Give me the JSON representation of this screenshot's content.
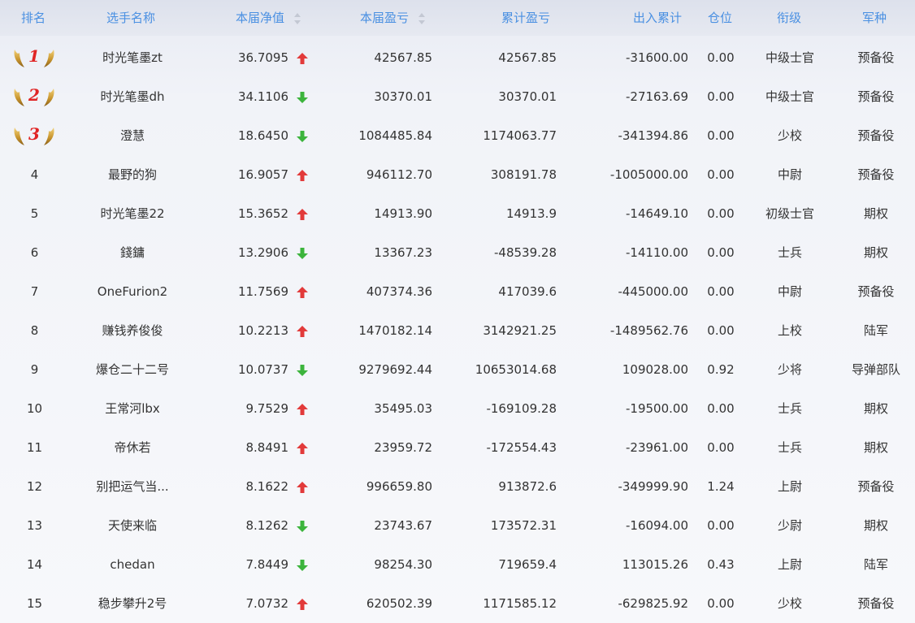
{
  "headers": {
    "rank": "排名",
    "name": "选手名称",
    "nav": "本届净值",
    "current_pnl": "本届盈亏",
    "cumulative_pnl": "累计盈亏",
    "inout": "出入累计",
    "position": "仓位",
    "grade": "衔级",
    "arm": "军种"
  },
  "colors": {
    "accent": "#4a90e2",
    "up": "#e23a3a",
    "down": "#3cb43c",
    "medal_number": "#e02525"
  },
  "rows": [
    {
      "rank": "1",
      "medal": true,
      "name": "时光笔墨zt",
      "nav": "36.7095",
      "trend": "up",
      "current_pnl": "42567.85",
      "cumulative_pnl": "42567.85",
      "inout": "-31600.00",
      "position": "0.00",
      "grade": "中级士官",
      "arm": "预备役"
    },
    {
      "rank": "2",
      "medal": true,
      "name": "时光笔墨dh",
      "nav": "34.1106",
      "trend": "down",
      "current_pnl": "30370.01",
      "cumulative_pnl": "30370.01",
      "inout": "-27163.69",
      "position": "0.00",
      "grade": "中级士官",
      "arm": "预备役"
    },
    {
      "rank": "3",
      "medal": true,
      "name": "澄慧",
      "nav": "18.6450",
      "trend": "down",
      "current_pnl": "1084485.84",
      "cumulative_pnl": "1174063.77",
      "inout": "-341394.86",
      "position": "0.00",
      "grade": "少校",
      "arm": "预备役"
    },
    {
      "rank": "4",
      "medal": false,
      "name": "最野的狗",
      "nav": "16.9057",
      "trend": "up",
      "current_pnl": "946112.70",
      "cumulative_pnl": "308191.78",
      "inout": "-1005000.00",
      "position": "0.00",
      "grade": "中尉",
      "arm": "预备役"
    },
    {
      "rank": "5",
      "medal": false,
      "name": "时光笔墨22",
      "nav": "15.3652",
      "trend": "up",
      "current_pnl": "14913.90",
      "cumulative_pnl": "14913.9",
      "inout": "-14649.10",
      "position": "0.00",
      "grade": "初级士官",
      "arm": "期权"
    },
    {
      "rank": "6",
      "medal": false,
      "name": "錢鏞",
      "nav": "13.2906",
      "trend": "down",
      "current_pnl": "13367.23",
      "cumulative_pnl": "-48539.28",
      "inout": "-14110.00",
      "position": "0.00",
      "grade": "士兵",
      "arm": "期权"
    },
    {
      "rank": "7",
      "medal": false,
      "name": "OneFurion2",
      "nav": "11.7569",
      "trend": "up",
      "current_pnl": "407374.36",
      "cumulative_pnl": "417039.6",
      "inout": "-445000.00",
      "position": "0.00",
      "grade": "中尉",
      "arm": "预备役"
    },
    {
      "rank": "8",
      "medal": false,
      "name": "赚钱养俊俊",
      "nav": "10.2213",
      "trend": "up",
      "current_pnl": "1470182.14",
      "cumulative_pnl": "3142921.25",
      "inout": "-1489562.76",
      "position": "0.00",
      "grade": "上校",
      "arm": "陆军"
    },
    {
      "rank": "9",
      "medal": false,
      "name": "爆仓二十二号",
      "nav": "10.0737",
      "trend": "down",
      "current_pnl": "9279692.44",
      "cumulative_pnl": "10653014.68",
      "inout": "109028.00",
      "position": "0.92",
      "grade": "少将",
      "arm": "导弹部队"
    },
    {
      "rank": "10",
      "medal": false,
      "name": "王常河lbx",
      "nav": "9.7529",
      "trend": "up",
      "current_pnl": "35495.03",
      "cumulative_pnl": "-169109.28",
      "inout": "-19500.00",
      "position": "0.00",
      "grade": "士兵",
      "arm": "期权"
    },
    {
      "rank": "11",
      "medal": false,
      "name": "帝休若",
      "nav": "8.8491",
      "trend": "up",
      "current_pnl": "23959.72",
      "cumulative_pnl": "-172554.43",
      "inout": "-23961.00",
      "position": "0.00",
      "grade": "士兵",
      "arm": "期权"
    },
    {
      "rank": "12",
      "medal": false,
      "name": "别把运气当...",
      "nav": "8.1622",
      "trend": "up",
      "current_pnl": "996659.80",
      "cumulative_pnl": "913872.6",
      "inout": "-349999.90",
      "position": "1.24",
      "grade": "上尉",
      "arm": "预备役"
    },
    {
      "rank": "13",
      "medal": false,
      "name": "天使来临",
      "nav": "8.1262",
      "trend": "down",
      "current_pnl": "23743.67",
      "cumulative_pnl": "173572.31",
      "inout": "-16094.00",
      "position": "0.00",
      "grade": "少尉",
      "arm": "期权"
    },
    {
      "rank": "14",
      "medal": false,
      "name": "chedan",
      "nav": "7.8449",
      "trend": "down",
      "current_pnl": "98254.30",
      "cumulative_pnl": "719659.4",
      "inout": "113015.26",
      "position": "0.43",
      "grade": "上尉",
      "arm": "陆军"
    },
    {
      "rank": "15",
      "medal": false,
      "name": "稳步攀升2号",
      "nav": "7.0732",
      "trend": "up",
      "current_pnl": "620502.39",
      "cumulative_pnl": "1171585.12",
      "inout": "-629825.92",
      "position": "0.00",
      "grade": "少校",
      "arm": "预备役"
    }
  ]
}
